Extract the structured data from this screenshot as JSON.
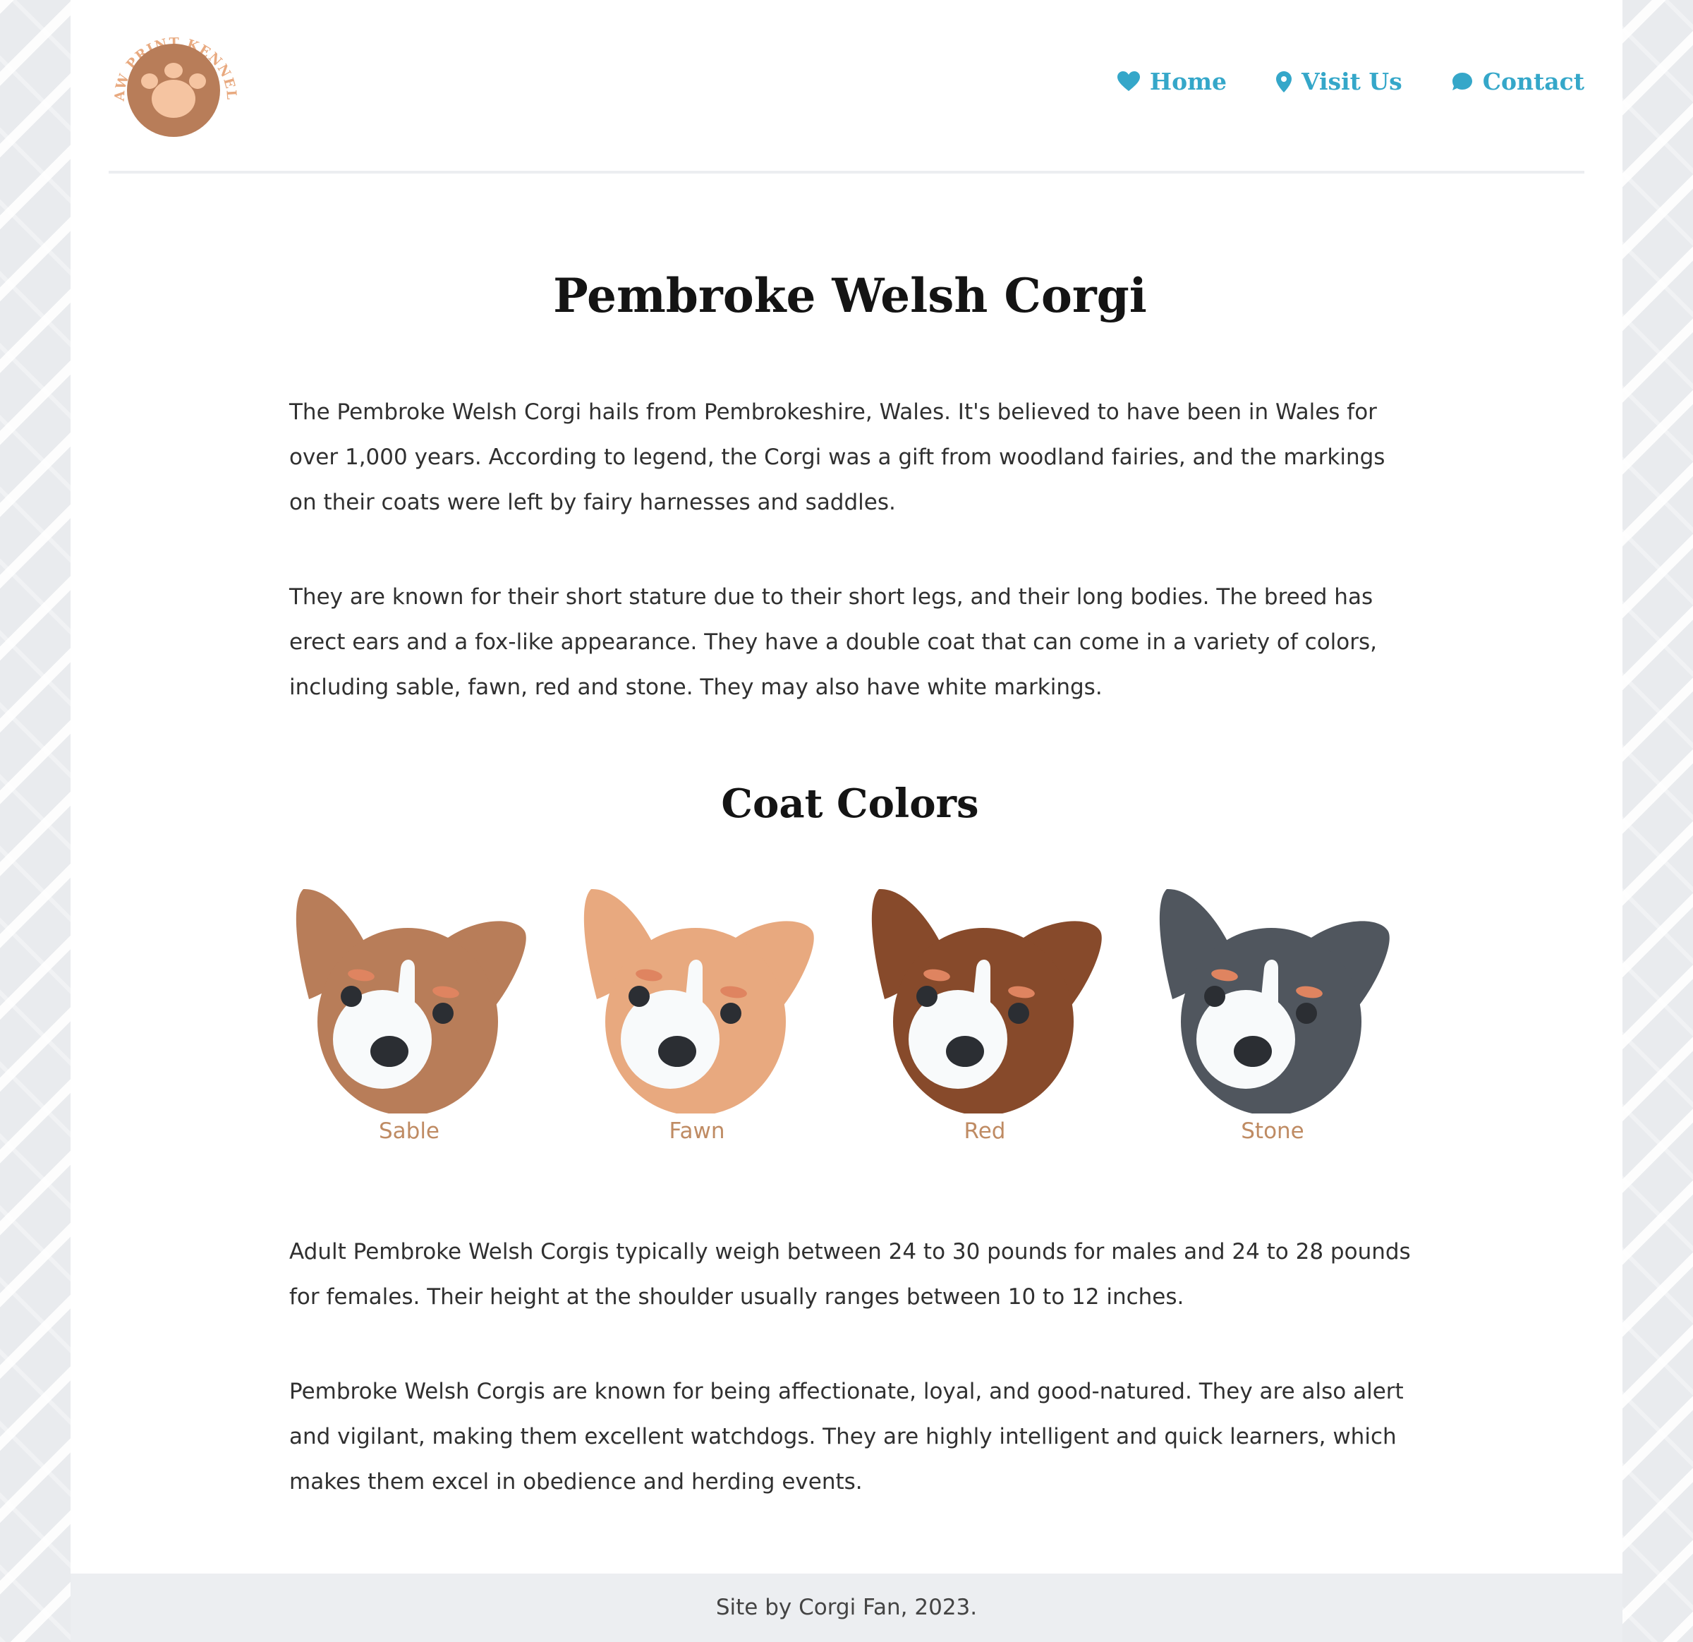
{
  "brand": {
    "logo_text": "PAW PRINT KENNELS"
  },
  "nav": {
    "home": {
      "label": "Home",
      "icon": "heart-icon"
    },
    "visit": {
      "label": "Visit Us",
      "icon": "map-pin-icon"
    },
    "contact": {
      "label": "Contact",
      "icon": "chat-bubble-icon"
    }
  },
  "main": {
    "title": "Pembroke Welsh Corgi",
    "paragraphs": [
      "The Pembroke Welsh Corgi hails from Pembrokeshire, Wales. It's believed to have been in Wales for over 1,000 years. According to legend, the Corgi was a gift from woodland fairies, and the markings on their coats were left by fairy harnesses and saddles.",
      "They are known for their short stature due to their short legs, and their long bodies. The breed has erect ears and a fox-like appearance. They have a double coat that can come in a variety of colors, including sable, fawn, red and stone. They may also have white markings.",
      "Adult Pembroke Welsh Corgis typically weigh between 24 to 30 pounds for males and 24 to 28 pounds for females. Their height at the shoulder usually ranges between 10 to 12 inches.",
      "Pembroke Welsh Corgis are known for being affectionate, loyal, and good-natured. They are also alert and vigilant, making them excellent watchdogs. They are highly intelligent and quick learners, which makes them excel in obedience and herding events."
    ],
    "coat_colors_heading": "Coat Colors",
    "coat_colors": [
      {
        "label": "Sable",
        "color": "#b87d59"
      },
      {
        "label": "Fawn",
        "color": "#e8a97f"
      },
      {
        "label": "Red",
        "color": "#874a2b"
      },
      {
        "label": "Stone",
        "color": "#50565e"
      }
    ]
  },
  "footer": {
    "text": "Site by Corgi Fan, 2023."
  },
  "colors": {
    "accent": "#35a7c9",
    "label": "#bf8b63",
    "logo_brown": "#b87d59",
    "logo_text": "#e8a97f"
  }
}
